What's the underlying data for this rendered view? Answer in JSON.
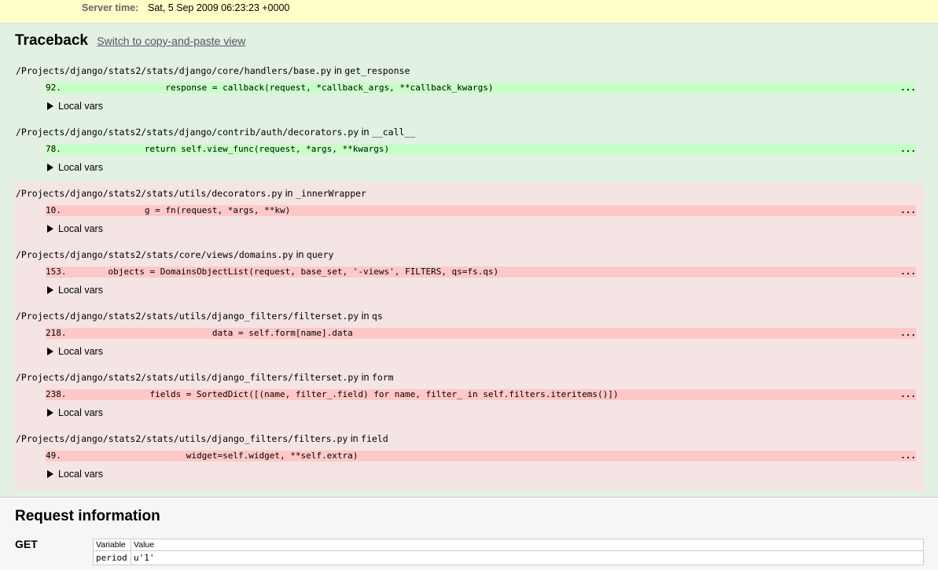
{
  "summary": {
    "server_time_label": "Server time:",
    "server_time_value": "Sat, 5 Sep 2009 06:23:23 +0000"
  },
  "traceback": {
    "title": "Traceback",
    "switch_link": "Switch to copy-and-paste view",
    "frames": [
      {
        "file": "/Projects/django/stats2/stats/django/core/handlers/base.py",
        "in": "in",
        "func": "get_response",
        "lineno": "92.",
        "code": "                response = callback(request, *callback_args, **callback_kwargs)",
        "dots": "...",
        "local_vars": "Local vars",
        "kind": "django"
      },
      {
        "file": "/Projects/django/stats2/stats/django/contrib/auth/decorators.py",
        "in": "in",
        "func": "__call__",
        "lineno": "78.",
        "code": "            return self.view_func(request, *args, **kwargs)",
        "dots": "...",
        "local_vars": "Local vars",
        "kind": "django"
      },
      {
        "file": "/Projects/django/stats2/stats/utils/decorators.py",
        "in": "in",
        "func": "_innerWrapper",
        "lineno": "10.",
        "code": "            g = fn(request, *args, **kw)",
        "dots": "...",
        "local_vars": "Local vars",
        "kind": "user"
      },
      {
        "file": "/Projects/django/stats2/stats/core/views/domains.py",
        "in": "in",
        "func": "query",
        "lineno": "153.",
        "code": "     objects = DomainsObjectList(request, base_set, '-views', FILTERS, qs=fs.qs)",
        "dots": "...",
        "local_vars": "Local vars",
        "kind": "user"
      },
      {
        "file": "/Projects/django/stats2/stats/utils/django_filters/filterset.py",
        "in": "in",
        "func": "qs",
        "lineno": "218.",
        "code": "                         data = self.form[name].data",
        "dots": "...",
        "local_vars": "Local vars",
        "kind": "user"
      },
      {
        "file": "/Projects/django/stats2/stats/utils/django_filters/filterset.py",
        "in": "in",
        "func": "form",
        "lineno": "238.",
        "code": "             fields = SortedDict([(name, filter_.field) for name, filter_ in self.filters.iteritems()])",
        "dots": "...",
        "local_vars": "Local vars",
        "kind": "user"
      },
      {
        "file": "/Projects/django/stats2/stats/utils/django_filters/filters.py",
        "in": "in",
        "func": "field",
        "lineno": "49.",
        "code": "                    widget=self.widget, **self.extra)",
        "dots": "...",
        "local_vars": "Local vars",
        "kind": "user"
      }
    ]
  },
  "request": {
    "title": "Request information",
    "get_label": "GET",
    "columns": [
      "Variable",
      "Value"
    ],
    "rows": [
      {
        "variable": "period",
        "value": "u'1'"
      }
    ]
  }
}
